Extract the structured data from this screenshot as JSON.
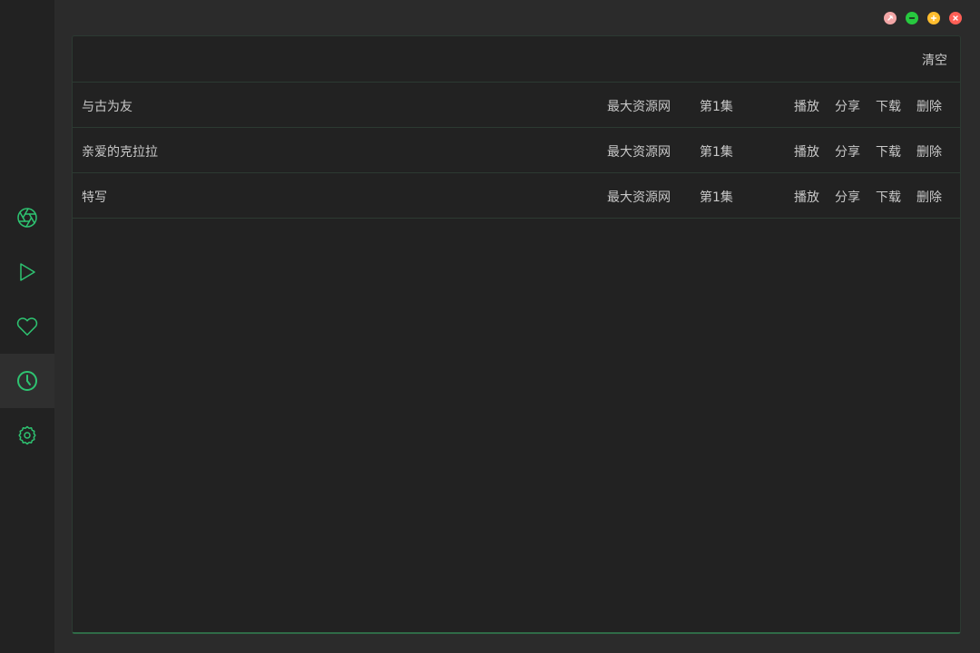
{
  "colors": {
    "accent": "#2ec371",
    "sidebar_bg": "#222222",
    "page_bg": "#2b2b2b",
    "panel_bg": "#222222",
    "text": "#c8c8c8",
    "pin_btn": "#f2a6a6",
    "min_btn": "#27c93f",
    "max_btn": "#ffbd2e",
    "close_btn": "#ff5f56"
  },
  "sidebar": {
    "items": [
      {
        "icon": "aperture-icon",
        "name": "film-library"
      },
      {
        "icon": "play-icon",
        "name": "player"
      },
      {
        "icon": "heart-icon",
        "name": "favorites"
      },
      {
        "icon": "clock-icon",
        "name": "history",
        "active": true
      },
      {
        "icon": "gear-icon",
        "name": "settings"
      }
    ]
  },
  "window_controls": [
    "pin-icon",
    "minimize-icon",
    "maximize-icon",
    "close-icon"
  ],
  "header": {
    "clear_label": "清空"
  },
  "history": {
    "rows": [
      {
        "title": "与古为友",
        "source": "最大资源网",
        "episode": "第1集",
        "play": "播放",
        "share": "分享",
        "download": "下载",
        "delete": "删除"
      },
      {
        "title": "亲爱的克拉拉",
        "source": "最大资源网",
        "episode": "第1集",
        "play": "播放",
        "share": "分享",
        "download": "下载",
        "delete": "删除"
      },
      {
        "title": "特写",
        "source": "最大资源网",
        "episode": "第1集",
        "play": "播放",
        "share": "分享",
        "download": "下载",
        "delete": "删除"
      }
    ]
  }
}
